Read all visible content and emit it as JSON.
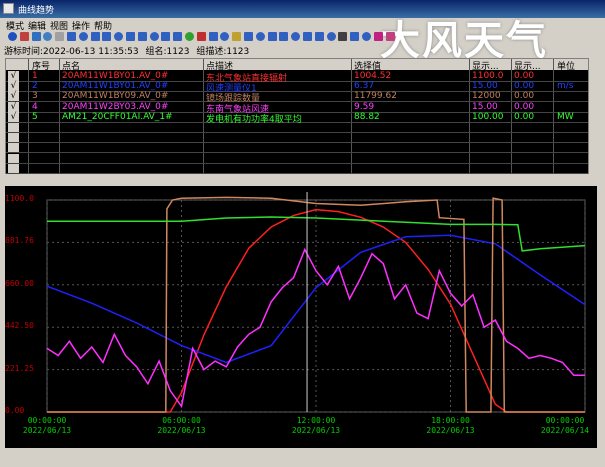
{
  "window": {
    "title": "曲线趋势",
    "watermark": "大风天气"
  },
  "menu": [
    "模式",
    "编辑",
    "视图",
    "操作",
    "帮助"
  ],
  "info": {
    "time": "游标时间:2022-06-13 11:35:53",
    "group": "组名:1123",
    "desc": "组描述:1123"
  },
  "table": {
    "headers": [
      "序号",
      "点名",
      "点描述",
      "选择值",
      "显示...",
      "显示...",
      "单位"
    ],
    "rows": [
      {
        "check": "√",
        "num": "1",
        "name": "20AM11W1BY01.AV_0#",
        "desc": "东北气象站直接辐射",
        "value": "1004.52",
        "max": "1100.0",
        "min": "0.00",
        "unit": "",
        "color": "#ff3030"
      },
      {
        "check": "√",
        "num": "2",
        "name": "20AM11W1BY01.AV_0#",
        "desc": "风速测量仪1",
        "value": "6.37",
        "max": "15.00",
        "min": "0.00",
        "unit": "m/s",
        "color": "#2040ff"
      },
      {
        "check": "√",
        "num": "3",
        "name": "20AM11W1BY09.AV_0#",
        "desc": "镜场跟踪数量",
        "value": "11799.62",
        "max": "12000",
        "min": "0.00",
        "unit": "",
        "color": "#c08060"
      },
      {
        "check": "√",
        "num": "4",
        "name": "20AM11W2BY03.AV_0#",
        "desc": "东南气象站风速",
        "value": "9.59",
        "max": "15.00",
        "min": "0.00",
        "unit": "",
        "color": "#ff40ff"
      },
      {
        "check": "√",
        "num": "5",
        "name": "AM21_20CFF01AI.AV_1#",
        "desc": "发电机有功功率4取平均",
        "value": "88.82",
        "max": "100.00",
        "min": "0.00",
        "unit": "MW",
        "color": "#30ff30"
      }
    ]
  },
  "chart_data": {
    "type": "line",
    "y_ticks": [
      "1100.0",
      "881.76",
      "660.00",
      "442.50",
      "221.25",
      "0.00"
    ],
    "x_ticks": [
      {
        "time": "00:00:00",
        "date": "2022/06/13"
      },
      {
        "time": "06:00:00",
        "date": "2022/06/13"
      },
      {
        "time": "12:00:00",
        "date": "2022/06/13"
      },
      {
        "time": "18:00:00",
        "date": "2022/06/13"
      },
      {
        "time": "00:00:00",
        "date": "2022/06/14"
      }
    ],
    "x_hours": [
      0,
      24
    ],
    "series": [
      {
        "color": "#ff2020",
        "range": [
          0,
          1100
        ],
        "x": [
          0,
          5.5,
          6,
          7,
          8,
          9,
          10,
          11,
          12,
          13,
          14,
          15,
          16,
          17,
          18,
          19,
          20,
          20.5,
          24
        ],
        "y": [
          0,
          0,
          100,
          400,
          650,
          850,
          960,
          1020,
          1050,
          1040,
          1010,
          960,
          880,
          740,
          560,
          300,
          40,
          0,
          0
        ]
      },
      {
        "color": "#2020ff",
        "range": [
          0,
          15
        ],
        "x": [
          0,
          2,
          4,
          6,
          8,
          10,
          12,
          14,
          16,
          18,
          20,
          22,
          24
        ],
        "y": [
          8.9,
          7.7,
          6.3,
          4.7,
          3.5,
          4.7,
          8.8,
          11.3,
          12.4,
          12.5,
          11.9,
          9.7,
          7.6
        ]
      },
      {
        "color": "#d08860",
        "range": [
          0,
          12000
        ],
        "x": [
          0,
          5.3,
          5.35,
          5.6,
          6.0,
          8,
          10,
          12,
          14,
          16,
          17.4,
          17.5,
          18.6,
          18.7,
          19.8,
          19.9,
          20.3,
          20.4,
          24
        ],
        "y": [
          0,
          0,
          11500,
          12000,
          12100,
          12150,
          12100,
          11800,
          11700,
          11900,
          12000,
          11000,
          10900,
          0,
          0,
          12100,
          12000,
          0,
          0
        ]
      },
      {
        "color": "#ff30ff",
        "range": [
          0,
          15
        ],
        "x": [
          0,
          0.5,
          1,
          1.5,
          2,
          2.5,
          3,
          3.5,
          4,
          4.5,
          5,
          5.5,
          6,
          6.5,
          7,
          7.5,
          8,
          8.5,
          9,
          9.5,
          10,
          10.5,
          11,
          11.5,
          12,
          12.5,
          13,
          13.5,
          14,
          14.5,
          15,
          15.5,
          16,
          16.5,
          17,
          17.5,
          18,
          18.5,
          19,
          19.5,
          20,
          20.5,
          21,
          21.5,
          22,
          22.5,
          23,
          23.5,
          24
        ],
        "y": [
          4.5,
          4.0,
          5.0,
          3.8,
          4.6,
          3.5,
          5.5,
          4.0,
          3.2,
          2.0,
          3.6,
          1.5,
          0.4,
          4.5,
          3.0,
          3.6,
          3.2,
          4.6,
          5.5,
          6.0,
          7.8,
          8.8,
          9.5,
          11.5,
          10.0,
          9.0,
          10.3,
          8.0,
          9.5,
          11.2,
          10.5,
          8.0,
          9.0,
          7.0,
          6.6,
          10.0,
          8.4,
          7.5,
          8.3,
          6.0,
          6.5,
          5.0,
          4.5,
          3.8,
          4.0,
          3.8,
          3.5,
          2.6,
          2.6
        ]
      },
      {
        "color": "#30e030",
        "range": [
          0,
          100
        ],
        "x": [
          0,
          6,
          8,
          10,
          12,
          14,
          16,
          18,
          20,
          21,
          21.2,
          22,
          24
        ],
        "y": [
          90,
          90,
          91.5,
          92,
          91.5,
          90.5,
          89.5,
          88.5,
          88.5,
          88.3,
          76,
          77,
          78.5
        ]
      }
    ]
  }
}
